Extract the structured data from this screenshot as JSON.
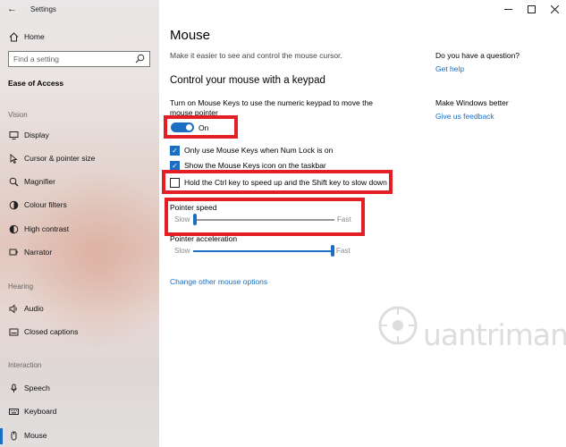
{
  "window": {
    "title": "Settings"
  },
  "sidebar": {
    "home_label": "Home",
    "search_placeholder": "Find a setting",
    "section_title": "Ease of Access",
    "groups": [
      {
        "title": "Vision"
      },
      {
        "title": "Hearing"
      },
      {
        "title": "Interaction"
      }
    ],
    "items": [
      {
        "label": "Display",
        "icon": "monitor-icon"
      },
      {
        "label": "Cursor & pointer size",
        "icon": "cursor-icon"
      },
      {
        "label": "Magnifier",
        "icon": "magnifier-icon"
      },
      {
        "label": "Colour filters",
        "icon": "colour-filter-icon"
      },
      {
        "label": "High contrast",
        "icon": "high-contrast-icon"
      },
      {
        "label": "Narrator",
        "icon": "narrator-icon"
      },
      {
        "label": "Audio",
        "icon": "speaker-icon"
      },
      {
        "label": "Closed captions",
        "icon": "captions-icon"
      },
      {
        "label": "Speech",
        "icon": "microphone-icon"
      },
      {
        "label": "Keyboard",
        "icon": "keyboard-icon"
      },
      {
        "label": "Mouse",
        "icon": "mouse-icon"
      }
    ],
    "selected_item": "Mouse"
  },
  "main": {
    "title": "Mouse",
    "subtitle": "Make it easier to see and control the mouse cursor.",
    "section_title": "Control your mouse with a keypad",
    "description": "Turn on Mouse Keys to use the numeric keypad to move the mouse pointer",
    "toggle": {
      "state_label": "On",
      "on": true
    },
    "checkboxes": [
      {
        "label": "Only use Mouse Keys when Num Lock is on",
        "checked": true
      },
      {
        "label": "Show the Mouse Keys icon on the taskbar",
        "checked": true
      },
      {
        "label": "Hold the Ctrl key to speed up and the Shift key to slow down",
        "checked": false
      }
    ],
    "pointer_speed": {
      "label": "Pointer speed",
      "min_label": "Slow",
      "max_label": "Fast",
      "value": 0.0
    },
    "pointer_acceleration": {
      "label": "Pointer acceleration",
      "min_label": "Slow",
      "max_label": "Fast",
      "value": 1.0
    },
    "link_other": "Change other mouse options"
  },
  "aside": {
    "question_title": "Do you have a question?",
    "question_link": "Get help",
    "better_title": "Make Windows better",
    "better_link": "Give us feedback"
  },
  "watermark": {
    "text": "uantrimang"
  },
  "colors": {
    "accent": "#1a6fc4",
    "highlight": "#e31e24"
  }
}
